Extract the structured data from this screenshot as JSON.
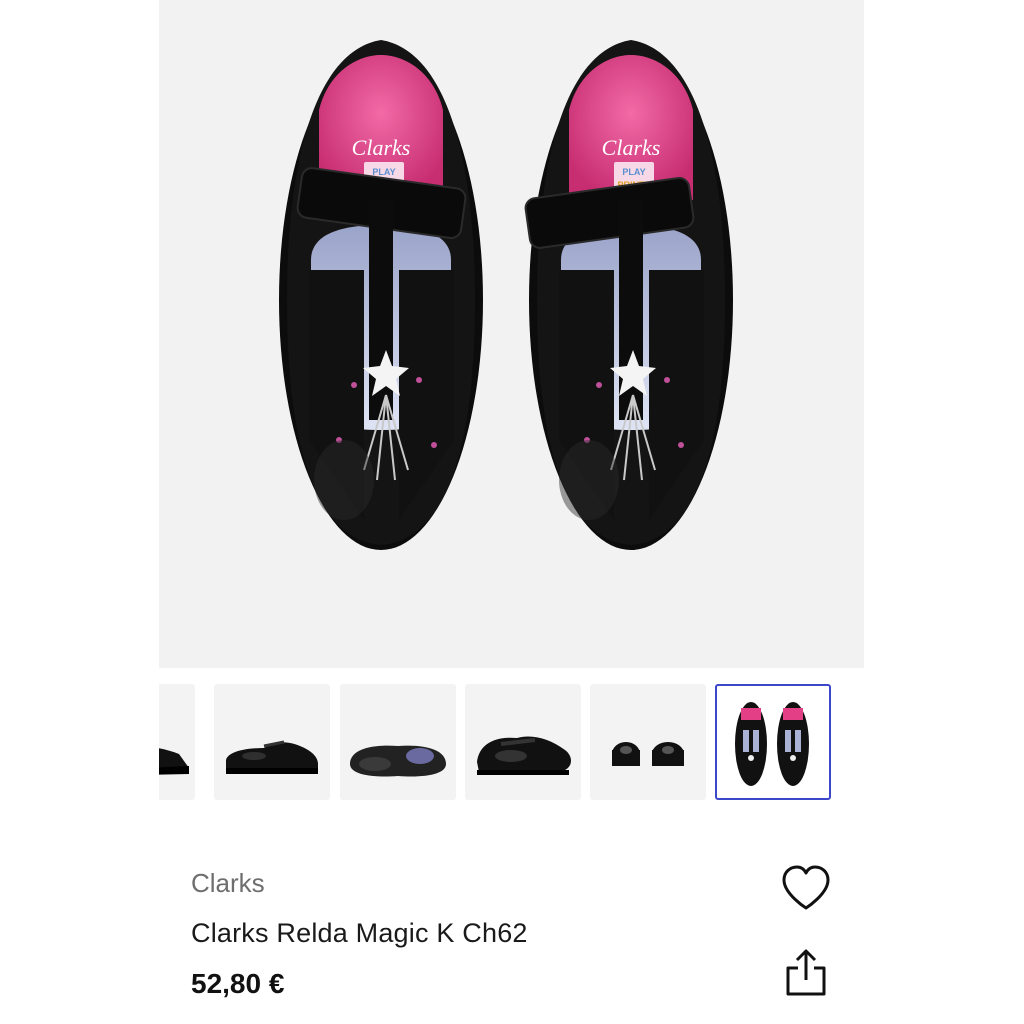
{
  "product": {
    "brand": "Clarks",
    "name": "Clarks Relda Magic K Ch62",
    "price": "52,80 €"
  },
  "main_image": {
    "alt": "Clarks Relda Magic K Ch62 top view",
    "insole_brand": "Clarks",
    "insole_sub": "PLAY PRINTS"
  },
  "thumbnails": [
    {
      "view": "partial side view",
      "active": false
    },
    {
      "view": "side view",
      "active": false
    },
    {
      "view": "sole view",
      "active": false
    },
    {
      "view": "angled side view",
      "active": false
    },
    {
      "view": "front view pair",
      "active": false
    },
    {
      "view": "top view pair",
      "active": true
    }
  ],
  "icons": {
    "favorite": "heart-icon",
    "share": "share-icon"
  },
  "colors": {
    "active_border": "#3d47c9",
    "image_bg": "#f2f2f2",
    "insole_pink": "#e23f86"
  }
}
